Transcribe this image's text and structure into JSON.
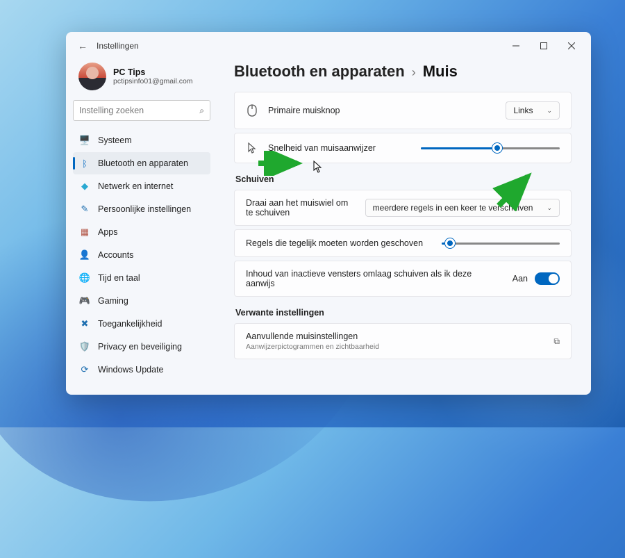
{
  "window": {
    "title": "Instellingen"
  },
  "profile": {
    "name": "PC Tips",
    "email": "pctipsinfo01@gmail.com"
  },
  "search": {
    "placeholder": "Instelling zoeken"
  },
  "nav": {
    "items": [
      {
        "icon": "🖥️",
        "color": "#3b82c4",
        "label": "Systeem"
      },
      {
        "icon": "ᛒ",
        "color": "#0067c0",
        "label": "Bluetooth en apparaten",
        "active": true
      },
      {
        "icon": "◆",
        "color": "#2aa9d2",
        "label": "Netwerk en internet"
      },
      {
        "icon": "✎",
        "color": "#1f6fb0",
        "label": "Persoonlijke instellingen"
      },
      {
        "icon": "▦",
        "color": "#b4594a",
        "label": "Apps"
      },
      {
        "icon": "👤",
        "color": "#3a9f5a",
        "label": "Accounts"
      },
      {
        "icon": "🌐",
        "color": "#c98a2b",
        "label": "Tijd en taal"
      },
      {
        "icon": "🎮",
        "color": "#6a6f78",
        "label": "Gaming"
      },
      {
        "icon": "✖",
        "color": "#1f6fb0",
        "label": "Toegankelijkheid"
      },
      {
        "icon": "🛡️",
        "color": "#6a6f78",
        "label": "Privacy en beveiliging"
      },
      {
        "icon": "⟳",
        "color": "#1f6fb0",
        "label": "Windows Update"
      }
    ]
  },
  "breadcrumb": {
    "parent": "Bluetooth en apparaten",
    "current": "Muis"
  },
  "settings": {
    "primary_button": {
      "label": "Primaire muisknop",
      "value": "Links"
    },
    "pointer_speed": {
      "label": "Snelheid van muisaanwijzer",
      "percent": 55
    },
    "scroll_section": "Schuiven",
    "scroll_mode": {
      "label": "Draai aan het muiswiel om te schuiven",
      "value": "meerdere regels in een keer te verschuiven"
    },
    "lines_at_once": {
      "label": "Regels die tegelijk moeten worden geschoven",
      "percent": 7
    },
    "inactive": {
      "label": "Inhoud van inactieve vensters omlaag schuiven als ik deze aanwijs",
      "state": "Aan"
    },
    "related_section": "Verwante instellingen",
    "additional": {
      "label": "Aanvullende muisinstellingen",
      "sub": "Aanwijzerpictogrammen en zichtbaarheid"
    }
  }
}
